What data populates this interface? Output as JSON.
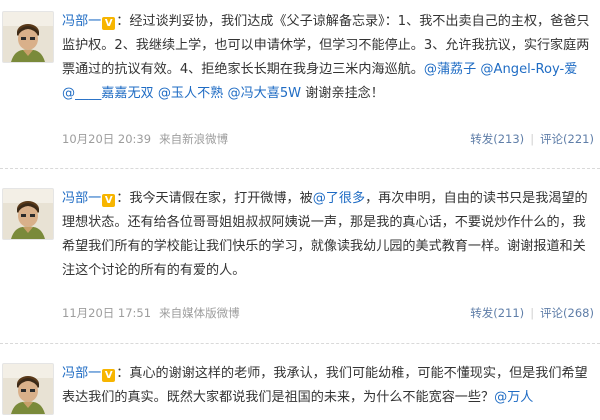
{
  "posts": [
    {
      "name": "冯部一",
      "badge": "V",
      "colon": "：",
      "body_1": "经过谈判妥协，我们达成《父子谅解备忘录》：1、我不出卖自己的主权，爸爸只监护权。2、我继续上学，也可以申请休学，但学习不能停止。3、允许我抗议，实行家庭两票通过的抗议有效。4、拒绝家长长期在我身边三米内海巡航。",
      "mention_1": "@蒲荔子",
      "mention_2": "@Angel-Roy-爱",
      "mention_3": "@____嘉嘉无双",
      "mention_4": "@玉人不熟",
      "mention_5": "@冯大喜5W",
      "body_2": "谢谢亲挂念！",
      "time": "10月20日 20:39",
      "source": "来自新浪微博",
      "repost": "转发(213)",
      "comment": "评论(221)"
    },
    {
      "name": "冯部一",
      "badge": "V",
      "colon": "：",
      "body_1": "我今天请假在家，打开微博，被",
      "mention_1": "@了很多",
      "body_2": "，再次申明，自由的读书只是我渴望的理想状态。还有给各位哥哥姐姐叔叔阿姨说一声，那是我的真心话，不要说炒作什么的，我希望我们所有的学校能让我们快乐的学习，就像读我幼儿园的美式教育一样。谢谢报道和关注这个讨论的所有的有爱的人。",
      "time": "11月20日 17:51",
      "source": "来自媒体版微博",
      "repost": "转发(211)",
      "comment": "评论(268)"
    },
    {
      "name": "冯部一",
      "badge": "V",
      "colon": "：",
      "body_1": "真心的谢谢这样的老师，我承认，我们可能幼稚，可能不懂现实，但是我们希望表达我们的真实。既然大家都说我们是祖国的未来，为什么不能宽容一些？",
      "mention_1": "@万人"
    }
  ]
}
